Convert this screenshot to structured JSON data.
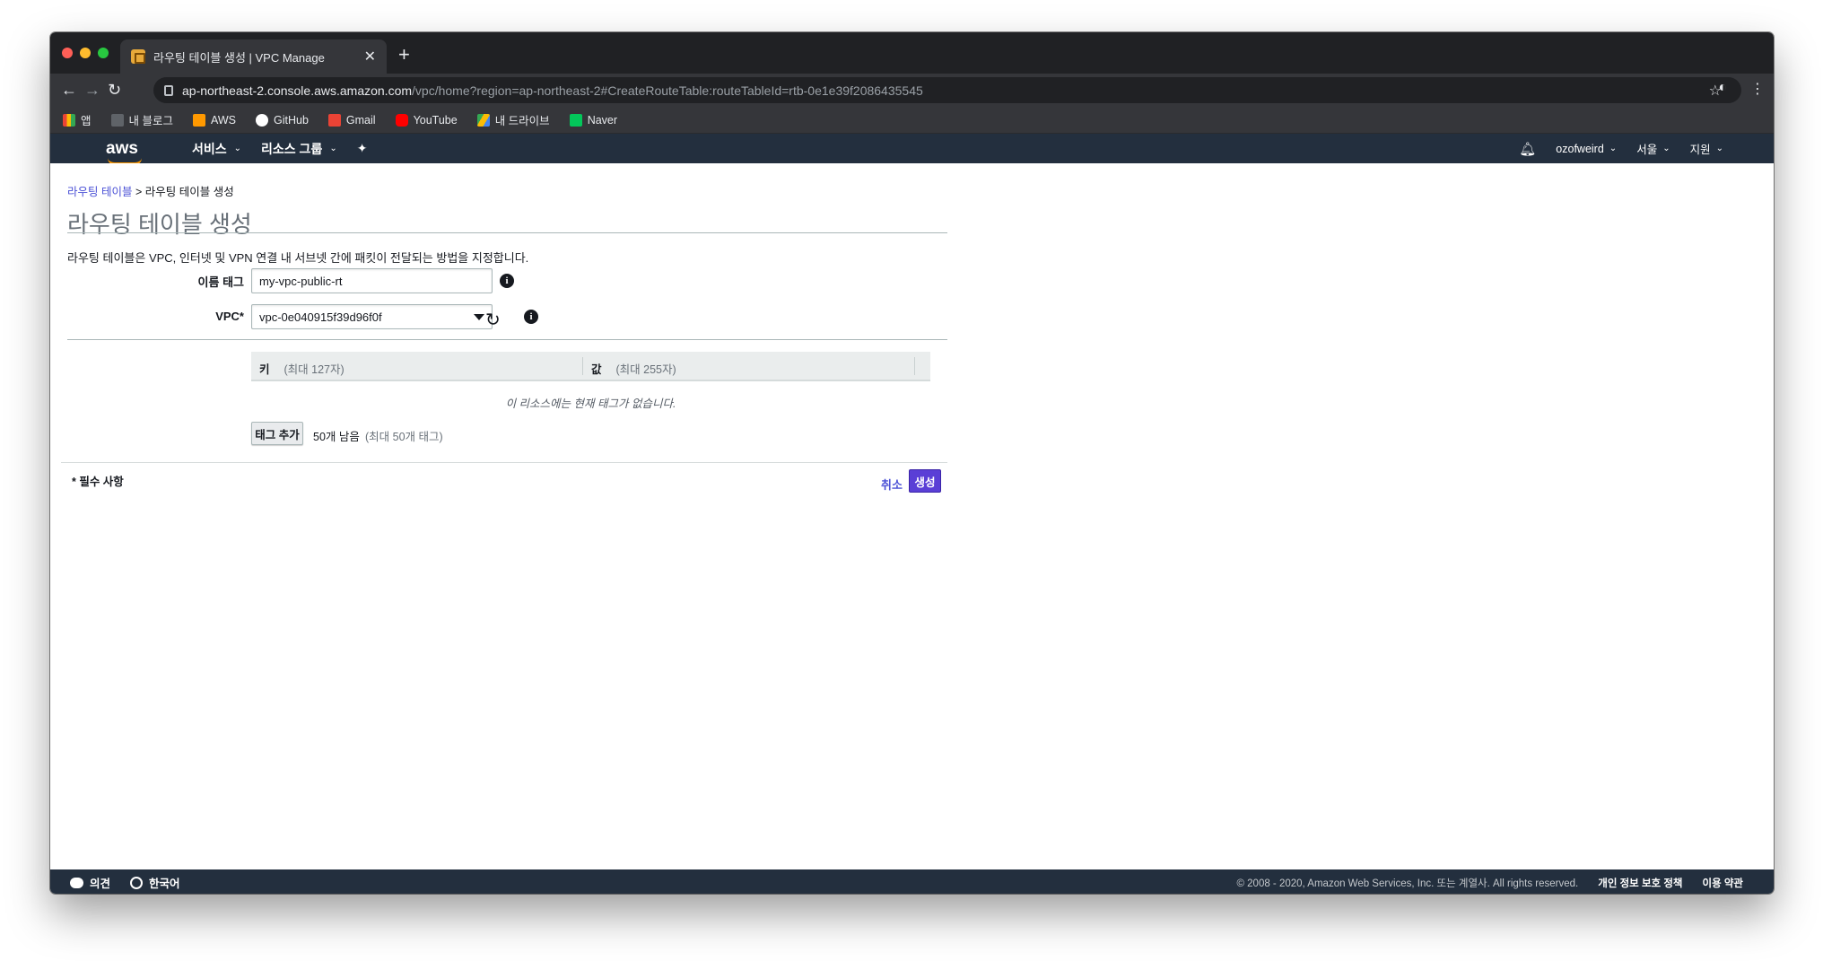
{
  "browser": {
    "tab_title": "라우팅 테이블 생성 | VPC Manage",
    "new_tab_label": "+",
    "url_host": "ap-northeast-2.console.aws.amazon.com",
    "url_path": "/vpc/home?region=ap-northeast-2#CreateRouteTable:routeTableId=rtb-0e1e39f2086435545",
    "bookmarks": [
      {
        "label": "앱",
        "color": "#ea4335"
      },
      {
        "label": "내 블로그",
        "color": "#bdc1c6"
      },
      {
        "label": "AWS",
        "color": "#ff9900"
      },
      {
        "label": "GitHub",
        "color": "#ffffff"
      },
      {
        "label": "Gmail",
        "color": "#ea4335"
      },
      {
        "label": "YouTube",
        "color": "#ff0000"
      },
      {
        "label": "내 드라이브",
        "color": "#34a853"
      },
      {
        "label": "Naver",
        "color": "#03c75a"
      }
    ]
  },
  "aws_header": {
    "logo": "aws",
    "services": "서비스",
    "resource_groups": "리소스 그룹",
    "user": "ozofweird",
    "region": "서울",
    "support": "지원"
  },
  "page": {
    "breadcrumb_link": "라우팅 테이블",
    "breadcrumb_sep": ">",
    "breadcrumb_current": "라우팅 테이블 생성",
    "title": "라우팅 테이블 생성",
    "description": "라우팅 테이블은 VPC, 인터넷 및 VPN 연결 내 서브넷 간에 패킷이 전달되는 방법을 지정합니다.",
    "name_tag_label": "이름 태그",
    "name_tag_value": "my-vpc-public-rt",
    "vpc_label": "VPC*",
    "vpc_value": "vpc-0e040915f39d96f0f",
    "tags": {
      "key_header": "키",
      "key_hint": "(최대 127자)",
      "value_header": "값",
      "value_hint": "(최대 255자)",
      "empty_text": "이 리소스에는 현재 태그가 없습니다.",
      "add_button": "태그 추가",
      "remaining": "50개 남음",
      "max": "(최대 50개 태그)"
    },
    "required_note": "* 필수 사항",
    "cancel": "취소",
    "create": "생성"
  },
  "footer": {
    "feedback": "의견",
    "language": "한국어",
    "copyright": "© 2008 - 2020, Amazon Web Services, Inc. 또는 계열사. All rights reserved.",
    "privacy": "개인 정보 보호 정책",
    "terms": "이용 약관"
  },
  "colors": {
    "aws_navy": "#232f3e",
    "link_purple": "#4b51d6",
    "primary_button": "#5a3fd6",
    "aws_orange": "#ff9900"
  }
}
